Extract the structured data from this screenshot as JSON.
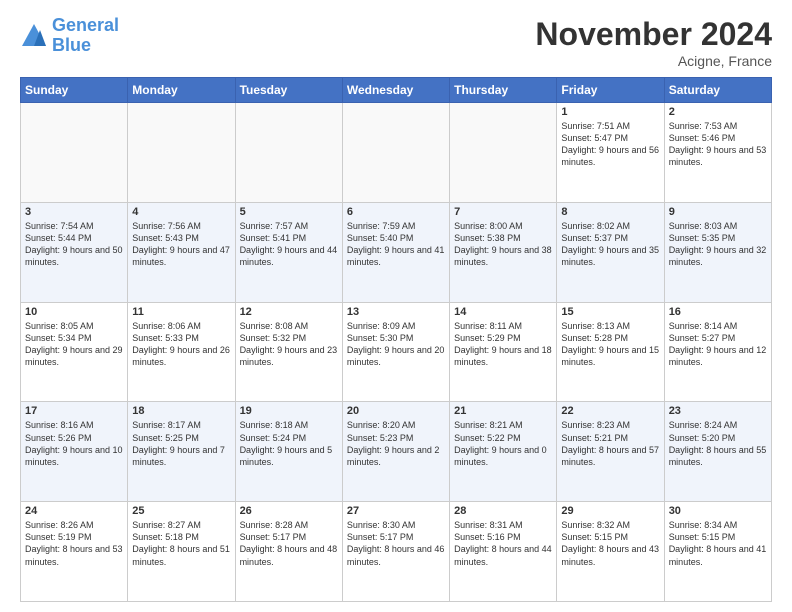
{
  "logo": {
    "line1": "General",
    "line2": "Blue"
  },
  "title": "November 2024",
  "subtitle": "Acigne, France",
  "days_of_week": [
    "Sunday",
    "Monday",
    "Tuesday",
    "Wednesday",
    "Thursday",
    "Friday",
    "Saturday"
  ],
  "weeks": [
    [
      {
        "day": "",
        "info": ""
      },
      {
        "day": "",
        "info": ""
      },
      {
        "day": "",
        "info": ""
      },
      {
        "day": "",
        "info": ""
      },
      {
        "day": "",
        "info": ""
      },
      {
        "day": "1",
        "info": "Sunrise: 7:51 AM\nSunset: 5:47 PM\nDaylight: 9 hours and 56 minutes."
      },
      {
        "day": "2",
        "info": "Sunrise: 7:53 AM\nSunset: 5:46 PM\nDaylight: 9 hours and 53 minutes."
      }
    ],
    [
      {
        "day": "3",
        "info": "Sunrise: 7:54 AM\nSunset: 5:44 PM\nDaylight: 9 hours and 50 minutes."
      },
      {
        "day": "4",
        "info": "Sunrise: 7:56 AM\nSunset: 5:43 PM\nDaylight: 9 hours and 47 minutes."
      },
      {
        "day": "5",
        "info": "Sunrise: 7:57 AM\nSunset: 5:41 PM\nDaylight: 9 hours and 44 minutes."
      },
      {
        "day": "6",
        "info": "Sunrise: 7:59 AM\nSunset: 5:40 PM\nDaylight: 9 hours and 41 minutes."
      },
      {
        "day": "7",
        "info": "Sunrise: 8:00 AM\nSunset: 5:38 PM\nDaylight: 9 hours and 38 minutes."
      },
      {
        "day": "8",
        "info": "Sunrise: 8:02 AM\nSunset: 5:37 PM\nDaylight: 9 hours and 35 minutes."
      },
      {
        "day": "9",
        "info": "Sunrise: 8:03 AM\nSunset: 5:35 PM\nDaylight: 9 hours and 32 minutes."
      }
    ],
    [
      {
        "day": "10",
        "info": "Sunrise: 8:05 AM\nSunset: 5:34 PM\nDaylight: 9 hours and 29 minutes."
      },
      {
        "day": "11",
        "info": "Sunrise: 8:06 AM\nSunset: 5:33 PM\nDaylight: 9 hours and 26 minutes."
      },
      {
        "day": "12",
        "info": "Sunrise: 8:08 AM\nSunset: 5:32 PM\nDaylight: 9 hours and 23 minutes."
      },
      {
        "day": "13",
        "info": "Sunrise: 8:09 AM\nSunset: 5:30 PM\nDaylight: 9 hours and 20 minutes."
      },
      {
        "day": "14",
        "info": "Sunrise: 8:11 AM\nSunset: 5:29 PM\nDaylight: 9 hours and 18 minutes."
      },
      {
        "day": "15",
        "info": "Sunrise: 8:13 AM\nSunset: 5:28 PM\nDaylight: 9 hours and 15 minutes."
      },
      {
        "day": "16",
        "info": "Sunrise: 8:14 AM\nSunset: 5:27 PM\nDaylight: 9 hours and 12 minutes."
      }
    ],
    [
      {
        "day": "17",
        "info": "Sunrise: 8:16 AM\nSunset: 5:26 PM\nDaylight: 9 hours and 10 minutes."
      },
      {
        "day": "18",
        "info": "Sunrise: 8:17 AM\nSunset: 5:25 PM\nDaylight: 9 hours and 7 minutes."
      },
      {
        "day": "19",
        "info": "Sunrise: 8:18 AM\nSunset: 5:24 PM\nDaylight: 9 hours and 5 minutes."
      },
      {
        "day": "20",
        "info": "Sunrise: 8:20 AM\nSunset: 5:23 PM\nDaylight: 9 hours and 2 minutes."
      },
      {
        "day": "21",
        "info": "Sunrise: 8:21 AM\nSunset: 5:22 PM\nDaylight: 9 hours and 0 minutes."
      },
      {
        "day": "22",
        "info": "Sunrise: 8:23 AM\nSunset: 5:21 PM\nDaylight: 8 hours and 57 minutes."
      },
      {
        "day": "23",
        "info": "Sunrise: 8:24 AM\nSunset: 5:20 PM\nDaylight: 8 hours and 55 minutes."
      }
    ],
    [
      {
        "day": "24",
        "info": "Sunrise: 8:26 AM\nSunset: 5:19 PM\nDaylight: 8 hours and 53 minutes."
      },
      {
        "day": "25",
        "info": "Sunrise: 8:27 AM\nSunset: 5:18 PM\nDaylight: 8 hours and 51 minutes."
      },
      {
        "day": "26",
        "info": "Sunrise: 8:28 AM\nSunset: 5:17 PM\nDaylight: 8 hours and 48 minutes."
      },
      {
        "day": "27",
        "info": "Sunrise: 8:30 AM\nSunset: 5:17 PM\nDaylight: 8 hours and 46 minutes."
      },
      {
        "day": "28",
        "info": "Sunrise: 8:31 AM\nSunset: 5:16 PM\nDaylight: 8 hours and 44 minutes."
      },
      {
        "day": "29",
        "info": "Sunrise: 8:32 AM\nSunset: 5:15 PM\nDaylight: 8 hours and 43 minutes."
      },
      {
        "day": "30",
        "info": "Sunrise: 8:34 AM\nSunset: 5:15 PM\nDaylight: 8 hours and 41 minutes."
      }
    ]
  ]
}
